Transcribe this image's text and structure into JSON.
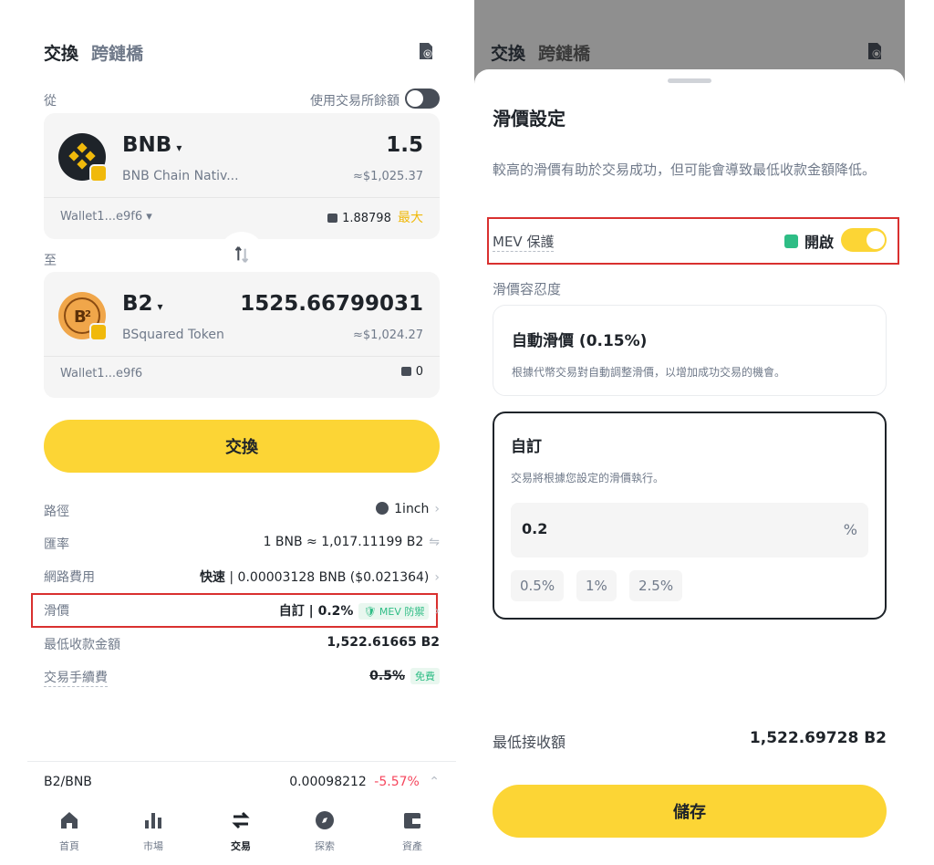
{
  "left": {
    "tabs": [
      "交換",
      "跨鏈橋"
    ],
    "from_label": "從",
    "use_exchange_balance": "使用交易所餘額",
    "from_token": {
      "symbol": "BNB",
      "name": "BNB Chain Nativ...",
      "amount": "1.5",
      "usd": "≈$1,025.37",
      "wallet": "Wallet1...e9f6",
      "balance": "1.88798",
      "max": "最大"
    },
    "to_label": "至",
    "to_token": {
      "symbol": "B2",
      "name": "BSquared Token",
      "amount": "1525.66799031",
      "usd": "≈$1,024.27",
      "wallet": "Wallet1...e9f6",
      "balance": "0"
    },
    "swap_button": "交換",
    "details": [
      {
        "key": "路徑",
        "value": "1inch"
      },
      {
        "key": "匯率",
        "value": "1 BNB ≈ 1,017.11199 B2"
      },
      {
        "key": "網路費用",
        "value_strong": "快速",
        "value": " | 0.00003128 BNB ($0.021364)"
      },
      {
        "key": "滑價",
        "value_strong": "自訂",
        "value": " | 0.2%",
        "tag": "MEV 防禦"
      },
      {
        "key": "最低收款金額",
        "value": "1,522.61665 B2"
      },
      {
        "key": "交易手續費",
        "value_strike": "0.5%",
        "tag": "免費"
      }
    ],
    "ticker": {
      "pair": "B2/BNB",
      "price": "0.00098212",
      "change": "-5.57%"
    },
    "nav": [
      "首頁",
      "市場",
      "交易",
      "探索",
      "資產"
    ]
  },
  "right": {
    "tabs": [
      "交換",
      "跨鏈橋"
    ],
    "sheet_title": "滑價設定",
    "sheet_desc": "較高的滑價有助於交易成功，但可能會導致最低收款金額降低。",
    "mev_label": "MEV 保護",
    "mev_state": "開啟",
    "tolerance_label": "滑價容忍度",
    "auto_title": "自動滑價 (0.15%)",
    "auto_desc": "根據代幣交易對自動調整滑價，以增加成功交易的機會。",
    "custom_title": "自訂",
    "custom_desc": "交易將根據您設定的滑價執行。",
    "custom_value": "0.2",
    "percent": "%",
    "chips": [
      "0.5%",
      "1%",
      "2.5%"
    ],
    "min_receive_label": "最低接收額",
    "min_receive_value": "1,522.69728 B2",
    "save_button": "儲存"
  },
  "colors": {
    "accent": "#fcd535",
    "positive": "#2ebd85",
    "negative": "#f6465d",
    "highlight": "#d9302f"
  }
}
